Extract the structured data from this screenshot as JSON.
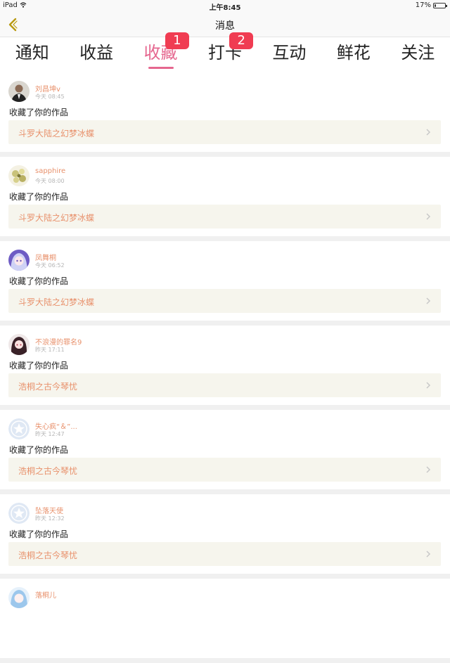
{
  "status_bar": {
    "device": "iPad",
    "time": "上午8:45",
    "battery": "17%",
    "battery_level": 0.17
  },
  "nav": {
    "title": "消息",
    "back_icon": "chevron-left-icon"
  },
  "tabs": [
    {
      "label": "通知",
      "badge": ""
    },
    {
      "label": "收益",
      "badge": ""
    },
    {
      "label": "收藏",
      "badge": "1",
      "active": true
    },
    {
      "label": "打卡",
      "badge": "2"
    },
    {
      "label": "互动",
      "badge": ""
    },
    {
      "label": "鲜花",
      "badge": ""
    },
    {
      "label": "关注",
      "badge": ""
    }
  ],
  "colors": {
    "accent": "#e5678f",
    "badge": "#f03c52",
    "username": "#e8916c",
    "work_bg": "#f6f5ed"
  },
  "messages": [
    {
      "user": "刘昌坤v",
      "time": "今天 08:45",
      "action": "收藏了你的作品",
      "work": "斗罗大陆之幻梦冰蝶",
      "avatar": "photo"
    },
    {
      "user": "sapphire",
      "time": "今天 08:00",
      "action": "收藏了你的作品",
      "work": "斗罗大陆之幻梦冰蝶",
      "avatar": "flower"
    },
    {
      "user": "凤舞桐",
      "time": "今天 06:52",
      "action": "收藏了你的作品",
      "work": "斗罗大陆之幻梦冰蝶",
      "avatar": "anime"
    },
    {
      "user": "不浪漫的罪名9",
      "time": "昨天 17:11",
      "action": "收藏了你的作品",
      "work": "浩桐之古今琴忧",
      "avatar": "anime-dark"
    },
    {
      "user": "失心疯“＆”...",
      "time": "昨天 12:47",
      "action": "收藏了你的作品",
      "work": "浩桐之古今琴忧",
      "avatar": "default-star"
    },
    {
      "user": "坠落天使",
      "time": "昨天 12:32",
      "action": "收藏了你的作品",
      "work": "浩桐之古今琴忧",
      "avatar": "default-star"
    },
    {
      "user": "落桐儿",
      "time": "",
      "action": "",
      "work": "",
      "avatar": "anime-blue"
    }
  ]
}
